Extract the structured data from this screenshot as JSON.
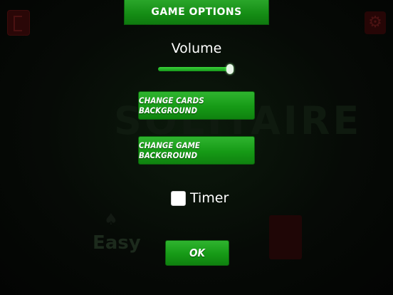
{
  "dialog": {
    "title": "GAME OPTIONS",
    "volume": {
      "label": "Volume",
      "level_fraction": 0.97
    },
    "change_cards_background_label": "CHANGE CARDS BACKGROUND",
    "change_game_background_label": "CHANGE GAME BACKGROUND",
    "timer": {
      "label": "Timer",
      "checked": false
    },
    "ok_label": "OK"
  },
  "background": {
    "title_text": "SOLITAIRE",
    "difficulty_label": "Easy"
  },
  "colors": {
    "accent_green": "#169a16",
    "background": "#050805"
  }
}
